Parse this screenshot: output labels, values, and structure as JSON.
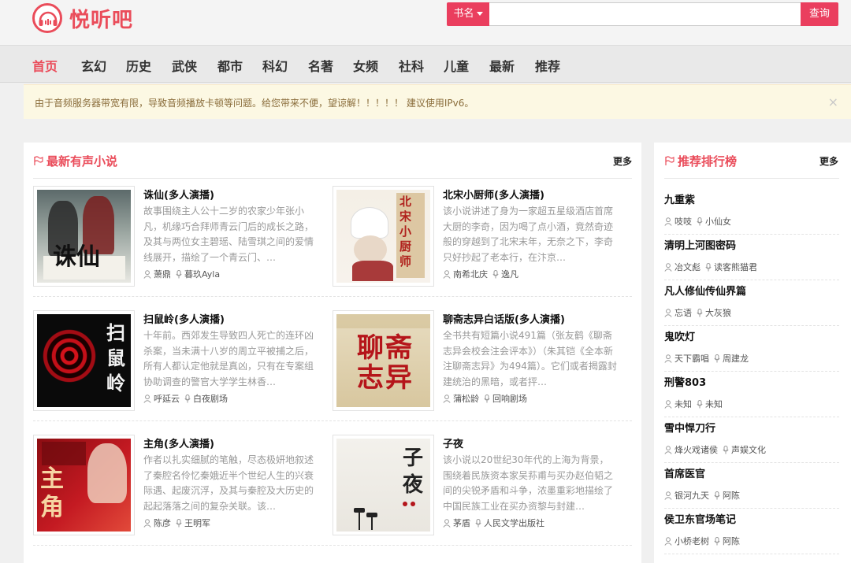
{
  "header": {
    "brand": "悦听吧",
    "search_type": "书名",
    "search_placeholder": "",
    "search_button": "查询",
    "accent_color": "#ea4c5a"
  },
  "nav": {
    "items": [
      "首页",
      "玄幻",
      "历史",
      "武侠",
      "都市",
      "科幻",
      "名著",
      "女频",
      "社科",
      "儿童",
      "最新",
      "推荐"
    ],
    "active": "首页"
  },
  "notice": {
    "text": "由于音频服务器带宽有限，导致音频播放卡顿等问题。给您带来不便，望谅解！！！！！  建议使用IPv6。",
    "close": "×"
  },
  "latest": {
    "title": "最新有声小说",
    "more": "更多",
    "books": [
      {
        "title": "诛仙(多人演播)",
        "desc": "故事围绕主人公十二岁的农家少年张小凡，机缘巧合拜师青云门后的成长之路，及其与两位女主碧瑶、陆雪琪之间的爱情线展开，描绘了一个青云门、…",
        "author": "萧鼎",
        "narrator": "暮玖Ayla",
        "cover_text": "诛仙"
      },
      {
        "title": "北宋小厨师(多人演播)",
        "desc": "该小说讲述了身为一家超五星级酒店首席大厨的李奇，因为喝了点小酒，竟然奇迹般的穿越到了北宋末年，无奈之下，李奇只好抄起了老本行，在汴京…",
        "author": "南希北庆",
        "narrator": "逸凡",
        "cover_text": "北宋小厨师"
      },
      {
        "title": "扫鼠岭(多人演播)",
        "desc": "十年前。西郊发生导致四人死亡的连环凶杀案，当未满十八岁的周立平被捕之后，所有人都认定他就是真凶，只有在专案组协助调查的警官大学学生林香…",
        "author": "呼延云",
        "narrator": "白夜剧场",
        "cover_text": "扫鼠岭"
      },
      {
        "title": "聊斋志异白话版(多人演播)",
        "desc": "全书共有短篇小说491篇（张友鹤《聊斋志异会校会注会评本》）（朱其铠《全本新注聊斋志异》为494篇）。它们或者揭露封建统治的黑暗，或者抨…",
        "author": "蒲松龄",
        "narrator": "回响剧场",
        "cover_text": "聊斋志异"
      },
      {
        "title": "主角(多人演播)",
        "desc": "作者以扎实细腻的笔触，尽态极妍地叙述了秦腔名伶忆秦娥近半个世纪人生的兴衰际遇、起废沉浮，及其与秦腔及大历史的起起落落之间的复杂关联。该…",
        "author": "陈彦",
        "narrator": "王明军",
        "cover_text": "主角"
      },
      {
        "title": "子夜",
        "desc": "该小说以20世纪30年代的上海为背景，围绕着民族资本家吴荪甫与买办赵伯韬之间的尖锐矛盾和斗争，浓墨重彩地描绘了中国民族工业在买办资黎与封建…",
        "author": "茅盾",
        "narrator": "人民文学出版社",
        "cover_text": "子夜"
      }
    ]
  },
  "ranking": {
    "title": "推荐排行榜",
    "more": "更多",
    "items": [
      {
        "title": "九重紫",
        "author": "吱吱",
        "narrator": "小仙女"
      },
      {
        "title": "清明上河图密码",
        "author": "冶文彪",
        "narrator": "读客熊猫君"
      },
      {
        "title": "凡人修仙传仙界篇",
        "author": "忘语",
        "narrator": "大灰狼"
      },
      {
        "title": "鬼吹灯",
        "author": "天下霸唱",
        "narrator": "周建龙"
      },
      {
        "title": "刑警803",
        "author": "未知",
        "narrator": "未知"
      },
      {
        "title": "雪中悍刀行",
        "author": "烽火戏诸侯",
        "narrator": "声娱文化"
      },
      {
        "title": "首席医官",
        "author": "银河九天",
        "narrator": "阿陈"
      },
      {
        "title": "侯卫东官场笔记",
        "author": "小桥老树",
        "narrator": "阿陈"
      }
    ]
  }
}
